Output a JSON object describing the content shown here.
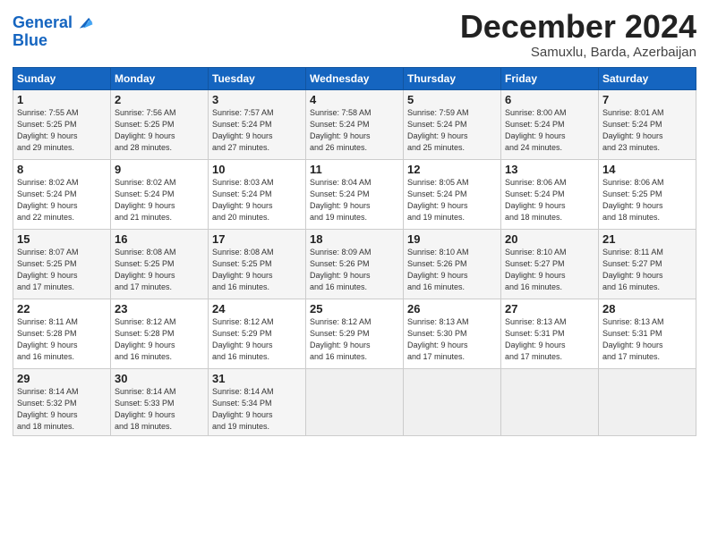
{
  "header": {
    "logo_line1": "General",
    "logo_line2": "Blue",
    "month": "December 2024",
    "location": "Samuxlu, Barda, Azerbaijan"
  },
  "weekdays": [
    "Sunday",
    "Monday",
    "Tuesday",
    "Wednesday",
    "Thursday",
    "Friday",
    "Saturday"
  ],
  "weeks": [
    [
      {
        "day": "1",
        "lines": [
          "Sunrise: 7:55 AM",
          "Sunset: 5:25 PM",
          "Daylight: 9 hours",
          "and 29 minutes."
        ]
      },
      {
        "day": "2",
        "lines": [
          "Sunrise: 7:56 AM",
          "Sunset: 5:25 PM",
          "Daylight: 9 hours",
          "and 28 minutes."
        ]
      },
      {
        "day": "3",
        "lines": [
          "Sunrise: 7:57 AM",
          "Sunset: 5:24 PM",
          "Daylight: 9 hours",
          "and 27 minutes."
        ]
      },
      {
        "day": "4",
        "lines": [
          "Sunrise: 7:58 AM",
          "Sunset: 5:24 PM",
          "Daylight: 9 hours",
          "and 26 minutes."
        ]
      },
      {
        "day": "5",
        "lines": [
          "Sunrise: 7:59 AM",
          "Sunset: 5:24 PM",
          "Daylight: 9 hours",
          "and 25 minutes."
        ]
      },
      {
        "day": "6",
        "lines": [
          "Sunrise: 8:00 AM",
          "Sunset: 5:24 PM",
          "Daylight: 9 hours",
          "and 24 minutes."
        ]
      },
      {
        "day": "7",
        "lines": [
          "Sunrise: 8:01 AM",
          "Sunset: 5:24 PM",
          "Daylight: 9 hours",
          "and 23 minutes."
        ]
      }
    ],
    [
      {
        "day": "8",
        "lines": [
          "Sunrise: 8:02 AM",
          "Sunset: 5:24 PM",
          "Daylight: 9 hours",
          "and 22 minutes."
        ]
      },
      {
        "day": "9",
        "lines": [
          "Sunrise: 8:02 AM",
          "Sunset: 5:24 PM",
          "Daylight: 9 hours",
          "and 21 minutes."
        ]
      },
      {
        "day": "10",
        "lines": [
          "Sunrise: 8:03 AM",
          "Sunset: 5:24 PM",
          "Daylight: 9 hours",
          "and 20 minutes."
        ]
      },
      {
        "day": "11",
        "lines": [
          "Sunrise: 8:04 AM",
          "Sunset: 5:24 PM",
          "Daylight: 9 hours",
          "and 19 minutes."
        ]
      },
      {
        "day": "12",
        "lines": [
          "Sunrise: 8:05 AM",
          "Sunset: 5:24 PM",
          "Daylight: 9 hours",
          "and 19 minutes."
        ]
      },
      {
        "day": "13",
        "lines": [
          "Sunrise: 8:06 AM",
          "Sunset: 5:24 PM",
          "Daylight: 9 hours",
          "and 18 minutes."
        ]
      },
      {
        "day": "14",
        "lines": [
          "Sunrise: 8:06 AM",
          "Sunset: 5:25 PM",
          "Daylight: 9 hours",
          "and 18 minutes."
        ]
      }
    ],
    [
      {
        "day": "15",
        "lines": [
          "Sunrise: 8:07 AM",
          "Sunset: 5:25 PM",
          "Daylight: 9 hours",
          "and 17 minutes."
        ]
      },
      {
        "day": "16",
        "lines": [
          "Sunrise: 8:08 AM",
          "Sunset: 5:25 PM",
          "Daylight: 9 hours",
          "and 17 minutes."
        ]
      },
      {
        "day": "17",
        "lines": [
          "Sunrise: 8:08 AM",
          "Sunset: 5:25 PM",
          "Daylight: 9 hours",
          "and 16 minutes."
        ]
      },
      {
        "day": "18",
        "lines": [
          "Sunrise: 8:09 AM",
          "Sunset: 5:26 PM",
          "Daylight: 9 hours",
          "and 16 minutes."
        ]
      },
      {
        "day": "19",
        "lines": [
          "Sunrise: 8:10 AM",
          "Sunset: 5:26 PM",
          "Daylight: 9 hours",
          "and 16 minutes."
        ]
      },
      {
        "day": "20",
        "lines": [
          "Sunrise: 8:10 AM",
          "Sunset: 5:27 PM",
          "Daylight: 9 hours",
          "and 16 minutes."
        ]
      },
      {
        "day": "21",
        "lines": [
          "Sunrise: 8:11 AM",
          "Sunset: 5:27 PM",
          "Daylight: 9 hours",
          "and 16 minutes."
        ]
      }
    ],
    [
      {
        "day": "22",
        "lines": [
          "Sunrise: 8:11 AM",
          "Sunset: 5:28 PM",
          "Daylight: 9 hours",
          "and 16 minutes."
        ]
      },
      {
        "day": "23",
        "lines": [
          "Sunrise: 8:12 AM",
          "Sunset: 5:28 PM",
          "Daylight: 9 hours",
          "and 16 minutes."
        ]
      },
      {
        "day": "24",
        "lines": [
          "Sunrise: 8:12 AM",
          "Sunset: 5:29 PM",
          "Daylight: 9 hours",
          "and 16 minutes."
        ]
      },
      {
        "day": "25",
        "lines": [
          "Sunrise: 8:12 AM",
          "Sunset: 5:29 PM",
          "Daylight: 9 hours",
          "and 16 minutes."
        ]
      },
      {
        "day": "26",
        "lines": [
          "Sunrise: 8:13 AM",
          "Sunset: 5:30 PM",
          "Daylight: 9 hours",
          "and 17 minutes."
        ]
      },
      {
        "day": "27",
        "lines": [
          "Sunrise: 8:13 AM",
          "Sunset: 5:31 PM",
          "Daylight: 9 hours",
          "and 17 minutes."
        ]
      },
      {
        "day": "28",
        "lines": [
          "Sunrise: 8:13 AM",
          "Sunset: 5:31 PM",
          "Daylight: 9 hours",
          "and 17 minutes."
        ]
      }
    ],
    [
      {
        "day": "29",
        "lines": [
          "Sunrise: 8:14 AM",
          "Sunset: 5:32 PM",
          "Daylight: 9 hours",
          "and 18 minutes."
        ]
      },
      {
        "day": "30",
        "lines": [
          "Sunrise: 8:14 AM",
          "Sunset: 5:33 PM",
          "Daylight: 9 hours",
          "and 18 minutes."
        ]
      },
      {
        "day": "31",
        "lines": [
          "Sunrise: 8:14 AM",
          "Sunset: 5:34 PM",
          "Daylight: 9 hours",
          "and 19 minutes."
        ]
      },
      {
        "day": "",
        "lines": []
      },
      {
        "day": "",
        "lines": []
      },
      {
        "day": "",
        "lines": []
      },
      {
        "day": "",
        "lines": []
      }
    ]
  ]
}
